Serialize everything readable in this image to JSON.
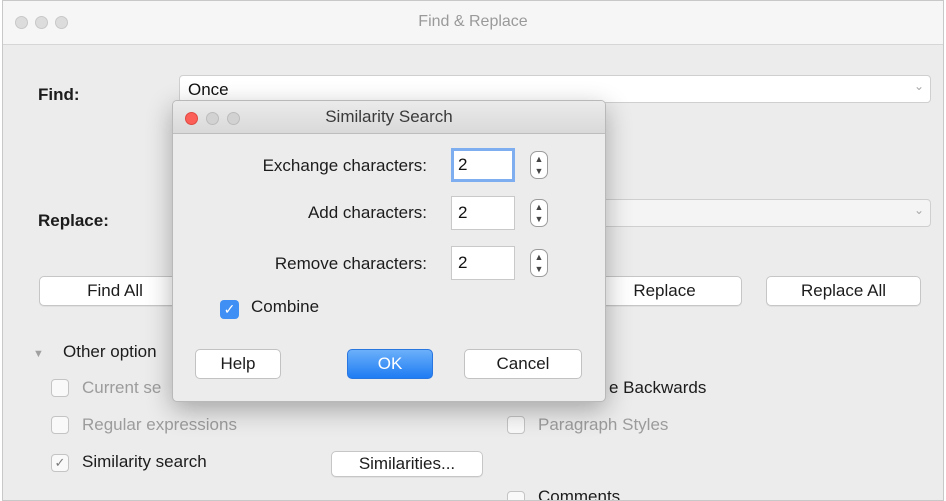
{
  "main_window": {
    "title": "Find & Replace",
    "find_label": "Find:",
    "find_value": "Once",
    "replace_label": "Replace:",
    "replace_value": "",
    "buttons": {
      "find_all": "Find All",
      "replace": "Replace",
      "replace_all": "Replace All"
    },
    "other_options_label": "Other option",
    "options": {
      "current_selection": "Current se",
      "regular_expressions": "Regular expressions",
      "similarity_search": "Similarity search",
      "similarity_search_checked": true,
      "similarities_button": "Similarities...",
      "backwards": "e Backwards",
      "paragraph_styles": "Paragraph Styles",
      "comments": "Comments"
    }
  },
  "dialog": {
    "title": "Similarity Search",
    "fields": [
      {
        "label": "Exchange characters:",
        "value": "2"
      },
      {
        "label": "Add characters:",
        "value": "2"
      },
      {
        "label": "Remove characters:",
        "value": "2"
      }
    ],
    "combine_label": "Combine",
    "combine_checked": true,
    "buttons": {
      "help": "Help",
      "ok": "OK",
      "cancel": "Cancel"
    }
  },
  "icons": {
    "close": "close-icon",
    "minimize": "minimize-icon",
    "zoom": "zoom-icon",
    "chevron": "chevron-down-icon",
    "stepper": "stepper-icon",
    "checkmark": "checkmark-icon",
    "disclosure": "disclosure-triangle-icon"
  },
  "colors": {
    "accent": "#3f8ff4",
    "close_red": "#fc5f57",
    "focus_ring": "#7eaef0"
  }
}
